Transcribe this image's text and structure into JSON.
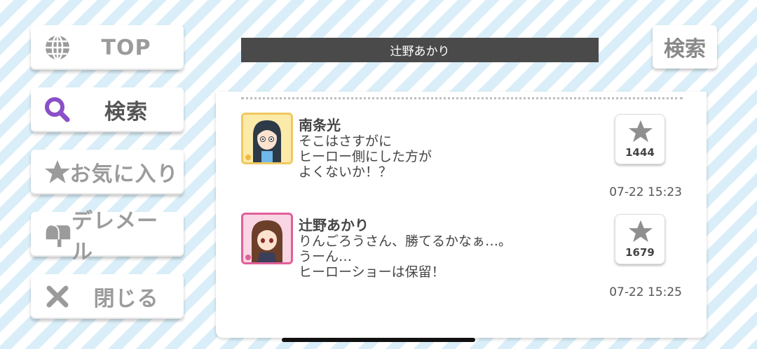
{
  "sidebar": {
    "items": [
      {
        "label": "TOP",
        "icon": "globe-icon"
      },
      {
        "label": "検索",
        "icon": "search-icon"
      },
      {
        "label": "お気に入り",
        "icon": "star-icon"
      },
      {
        "label": "デレメール",
        "icon": "mailbox-icon"
      },
      {
        "label": "閉じる",
        "icon": "close-icon"
      }
    ]
  },
  "header": {
    "title": "辻野あかり",
    "search_label": "検索"
  },
  "posts": [
    {
      "name": "南条光",
      "lines": [
        "そこはさすがに",
        "ヒーロー側にした方が",
        "よくないか！？"
      ],
      "stars": "1444",
      "time": "07-22 15:23",
      "avatar_frame_color": "#f0c860"
    },
    {
      "name": "辻野あかり",
      "lines": [
        "りんごろうさん、勝てるかなぁ…。",
        "うーん…",
        "ヒーローショーは保留！"
      ],
      "stars": "1679",
      "time": "07-22 15:25",
      "avatar_frame_color": "#e0609a"
    }
  ],
  "colors": {
    "accent_purple": "#8a4fc8",
    "title_bar": "#4a4a4a",
    "stripe": "#d9eef8"
  }
}
